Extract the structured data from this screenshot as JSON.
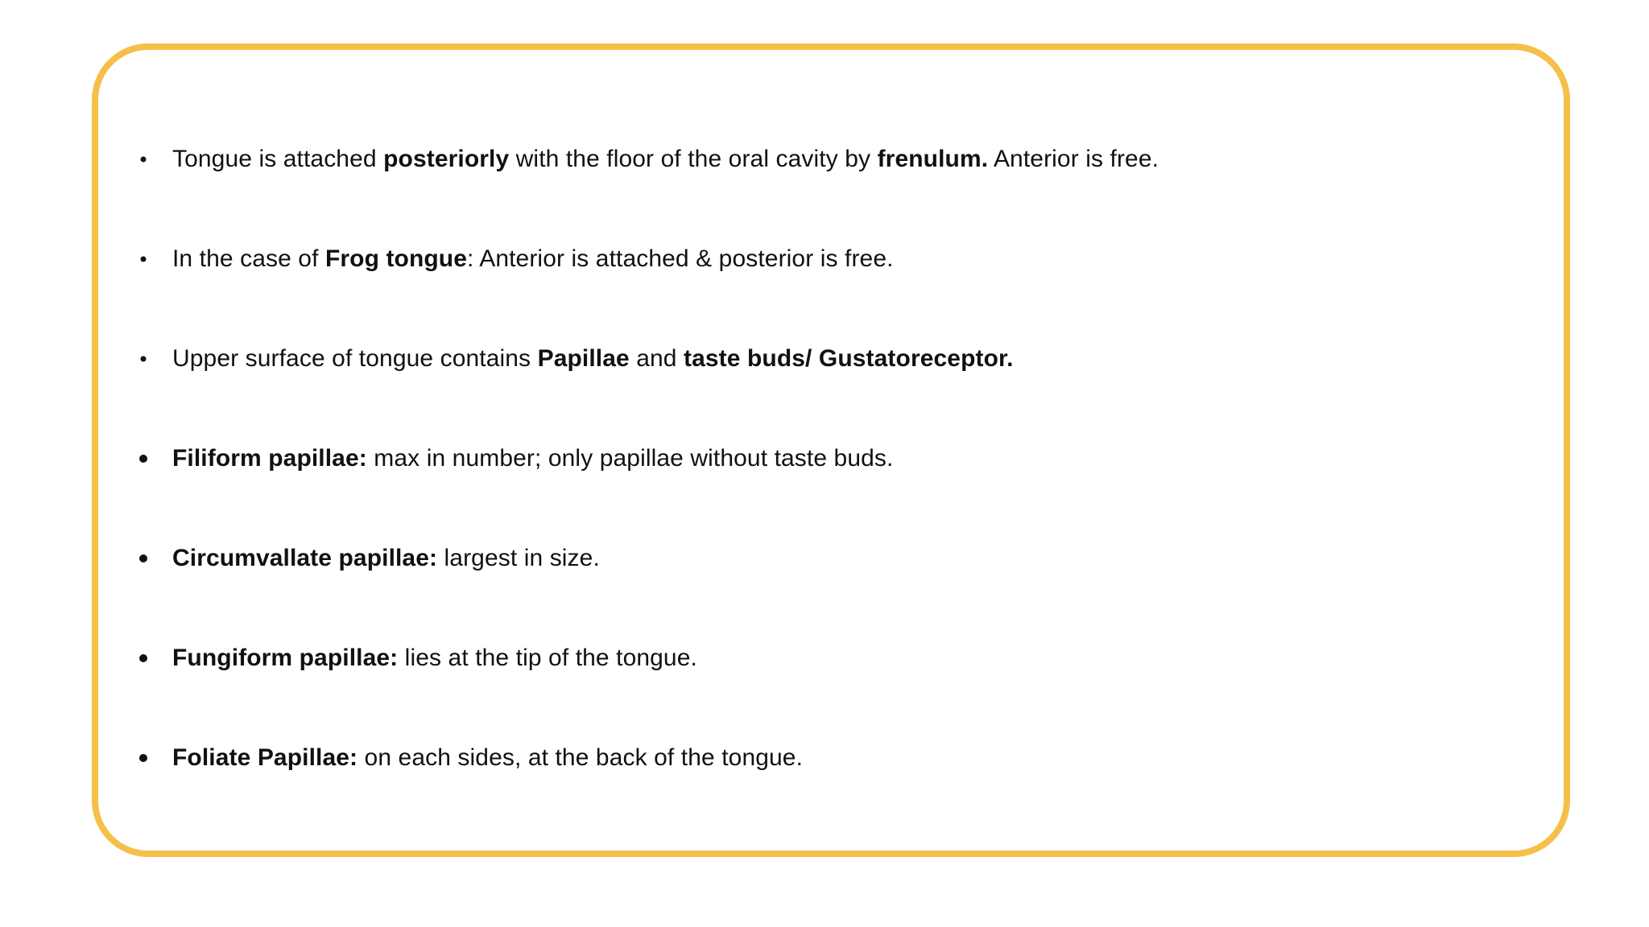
{
  "slide": {
    "accent_color": "#f5c04a",
    "bullets": [
      {
        "style": "small",
        "parts": [
          {
            "text": "Tongue is attached ",
            "bold": false
          },
          {
            "text": "posteriorly",
            "bold": true
          },
          {
            "text": " with the floor of the oral cavity by ",
            "bold": false
          },
          {
            "text": "frenulum.",
            "bold": true
          },
          {
            "text": " Anterior is free.",
            "bold": false
          }
        ]
      },
      {
        "style": "small",
        "parts": [
          {
            "text": "In the case of ",
            "bold": false
          },
          {
            "text": "Frog tongue",
            "bold": true
          },
          {
            "text": ": Anterior is attached & posterior is free.",
            "bold": false
          }
        ]
      },
      {
        "style": "small",
        "parts": [
          {
            "text": "Upper surface of tongue contains ",
            "bold": false
          },
          {
            "text": "Papillae",
            "bold": true
          },
          {
            "text": " and ",
            "bold": false
          },
          {
            "text": "taste buds/ Gustatoreceptor.",
            "bold": true
          }
        ]
      },
      {
        "style": "big",
        "parts": [
          {
            "text": "Filiform papillae:",
            "bold": true
          },
          {
            "text": " max in number; only papillae without taste buds.",
            "bold": false
          }
        ]
      },
      {
        "style": "big",
        "parts": [
          {
            "text": "Circumvallate papillae:",
            "bold": true
          },
          {
            "text": " largest in size.",
            "bold": false
          }
        ]
      },
      {
        "style": "big",
        "parts": [
          {
            "text": "Fungiform papillae:",
            "bold": true
          },
          {
            "text": " lies at the tip of the tongue.",
            "bold": false
          }
        ]
      },
      {
        "style": "big",
        "parts": [
          {
            "text": "Foliate Papillae:",
            "bold": true
          },
          {
            "text": " on each sides, at the back of the tongue.",
            "bold": false
          }
        ]
      }
    ]
  }
}
